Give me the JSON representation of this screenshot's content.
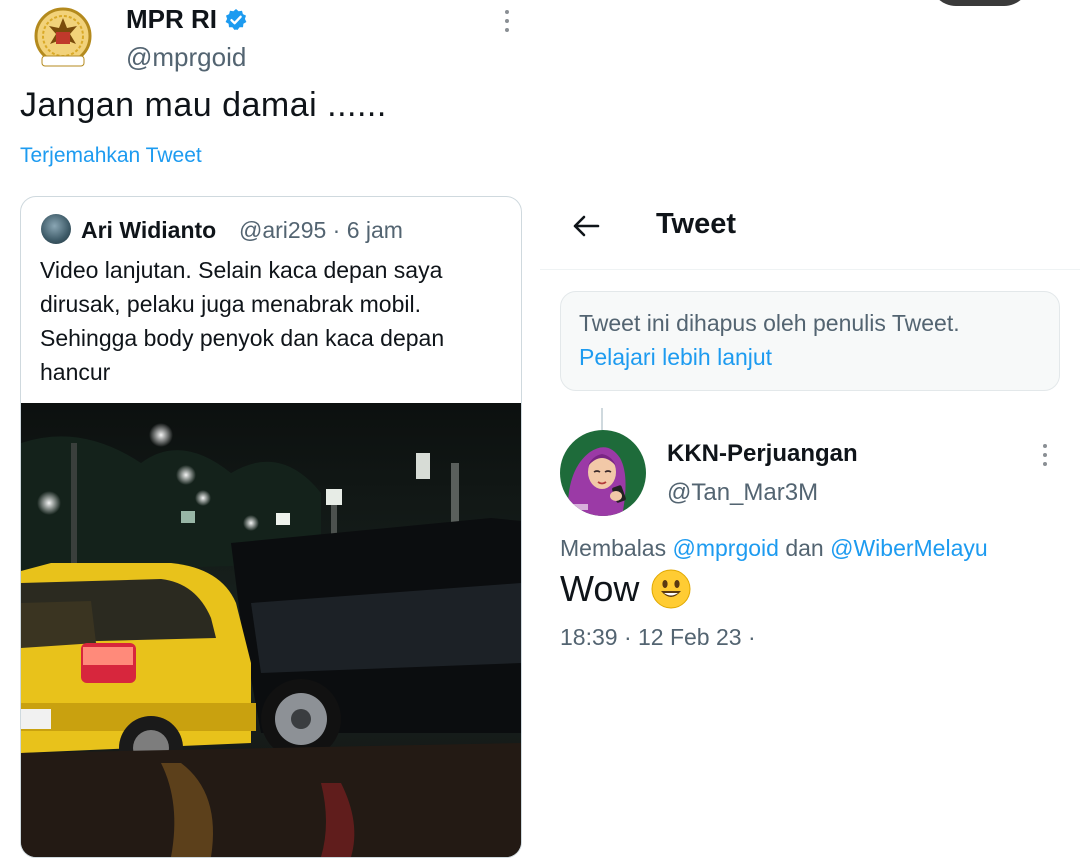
{
  "left_tweet": {
    "author_name": "MPR RI",
    "author_handle": "@mprgoid",
    "text": "Jangan mau damai ......",
    "translate_label": "Terjemahkan Tweet",
    "quoted": {
      "author_name": "Ari Widianto",
      "meta": "@ari295 · 6 jam",
      "lines": [
        "Video lanjutan. Selain kaca depan saya",
        "dirusak, pelaku juga menabrak mobil.",
        "Sehingga body penyok dan kaca depan",
        "hancur"
      ]
    }
  },
  "right_panel": {
    "title": "Tweet",
    "deleted_notice": "Tweet ini dihapus oleh penulis Tweet.",
    "learn_more": "Pelajari lebih lanjut",
    "reply": {
      "author_name": "KKN-Perjuangan",
      "author_handle": "@Tan_Mar3M",
      "replying_prefix": "Membalas",
      "replying_to_1": "@mprgoid",
      "replying_joiner": "dan",
      "replying_to_2": "@WiberMelayu",
      "text": "Wow",
      "timestamp": "18:39 · 12 Feb 23 ·"
    }
  },
  "icons": {
    "verified": "verified-badge-icon",
    "back": "back-arrow-icon",
    "more": "more-options-icon",
    "emoji": "smiling-face-emoji"
  },
  "colors": {
    "link": "#1d9bf0",
    "secondary_text": "#536471",
    "primary_text": "#0f1419",
    "border": "#cfd9de"
  }
}
